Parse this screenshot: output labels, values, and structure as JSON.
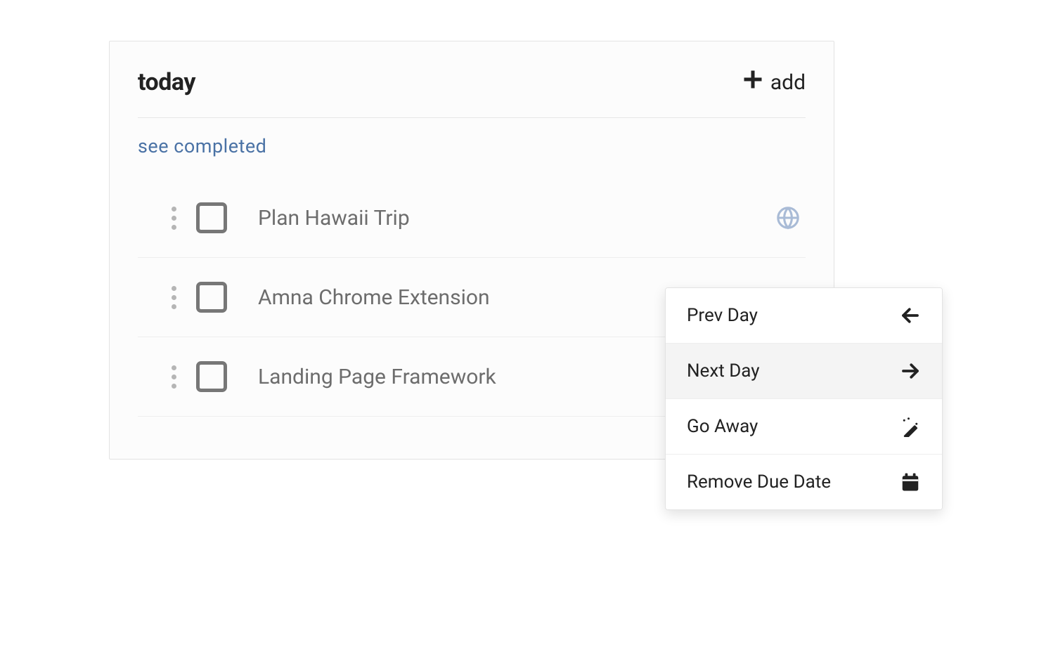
{
  "header": {
    "title": "today",
    "add_label": "add"
  },
  "links": {
    "see_completed": "see completed"
  },
  "tasks": [
    {
      "label": "Plan Hawaii Trip",
      "has_globe": true
    },
    {
      "label": "Amna Chrome Extension",
      "has_globe": false
    },
    {
      "label": "Landing Page Framework",
      "has_globe": false
    }
  ],
  "menu": {
    "prev_day": "Prev Day",
    "next_day": "Next Day",
    "go_away": "Go Away",
    "remove_due": "Remove Due Date"
  }
}
